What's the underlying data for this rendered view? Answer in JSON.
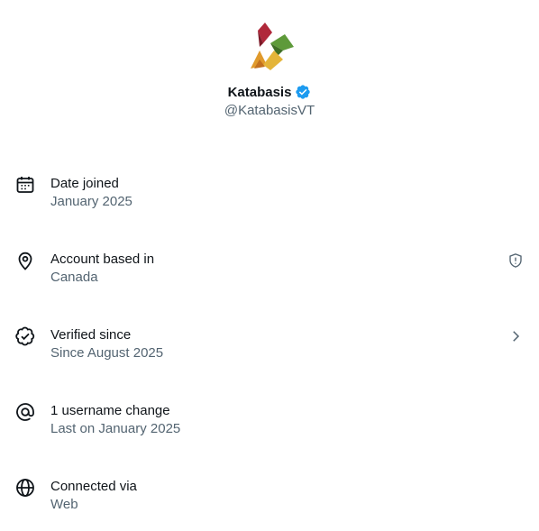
{
  "profile": {
    "display_name": "Katabasis",
    "handle": "@KatabasisVT",
    "verified": true,
    "badge_color": "#1d9bf0"
  },
  "about": {
    "rows": [
      {
        "icon": "calendar-icon",
        "label": "Date joined",
        "value": "January 2025"
      },
      {
        "icon": "location-pin-icon",
        "label": "Account based in",
        "value": "Canada",
        "trailing_icon": "shield-alert-icon"
      },
      {
        "icon": "verified-badge-outline-icon",
        "label": "Verified since",
        "value": "Since August 2025",
        "trailing_icon": "chevron-right-icon"
      },
      {
        "icon": "at-sign-icon",
        "label": "1 username change",
        "value": "Last on January 2025"
      },
      {
        "icon": "globe-icon",
        "label": "Connected via",
        "value": "Web"
      }
    ]
  },
  "colors": {
    "primary_text": "#0f1419",
    "secondary_text": "#536471",
    "accent": "#1d9bf0"
  }
}
